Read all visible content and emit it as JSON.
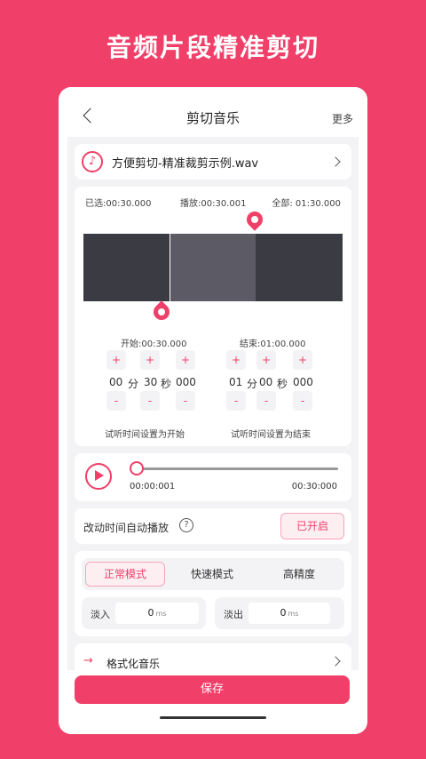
{
  "promo": {
    "title": "音频片段精准剪切"
  },
  "appbar": {
    "title": "剪切音乐",
    "more": "更多"
  },
  "file": {
    "name": "方便剪切-精准裁剪示例.wav"
  },
  "times": {
    "selected": "已选:00:30.000",
    "playhead": "播放:00:30.001",
    "total": "全部: 01:30.000"
  },
  "start": {
    "label": "开始:00:30.000",
    "minutes": "00",
    "min_unit": "分",
    "seconds": "30",
    "sec_unit": "秒",
    "millis": "000",
    "hint": "试听时间设置为开始"
  },
  "end": {
    "label": "结束:01:00.000",
    "minutes": "01",
    "min_unit": "分",
    "seconds": "00",
    "sec_unit": "秒",
    "millis": "000",
    "hint": "试听时间设置为结束"
  },
  "stepper": {
    "plus": "+",
    "minus": "-"
  },
  "player": {
    "current": "00:00:001",
    "duration": "00:30:000",
    "progress": 0.0
  },
  "auto_play": {
    "label": "改动时间自动播放",
    "help": "?",
    "state": "已开启"
  },
  "modes": {
    "normal": "正常模式",
    "fast": "快速模式",
    "precise": "高精度"
  },
  "fade": {
    "in_label": "淡入",
    "in_value": "0",
    "out_label": "淡出",
    "out_value": "0",
    "unit": "ms"
  },
  "format": {
    "label": "格式化音乐"
  },
  "save": {
    "label": "保存"
  },
  "colors": {
    "accent": "#f03f68",
    "wave_bg": "#3b3b43",
    "wave_sel": "#5c5b65"
  },
  "icons": {
    "back": "chevron-left-icon",
    "music": "music-note-icon",
    "play": "play-icon",
    "help": "help-icon",
    "format": "format-arrow-icon"
  }
}
